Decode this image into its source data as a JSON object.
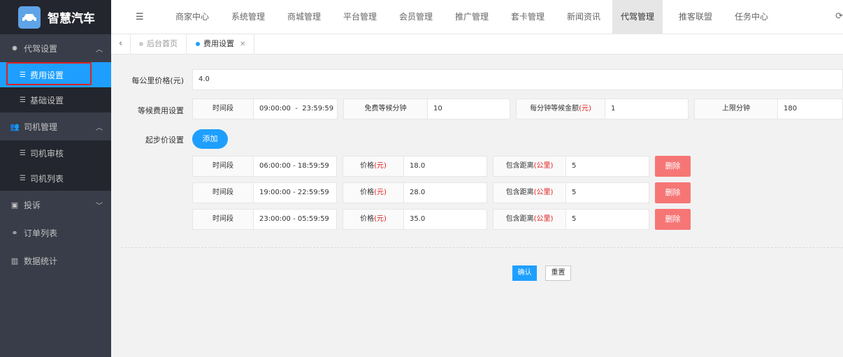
{
  "app": {
    "title": "智慧汽车"
  },
  "sidebar": {
    "groups": [
      {
        "label": "代驾设置",
        "icon": "gear-icon",
        "items": [
          {
            "label": "费用设置"
          },
          {
            "label": "基础设置"
          }
        ]
      },
      {
        "label": "司机管理",
        "icon": "users-icon",
        "items": [
          {
            "label": "司机审核"
          },
          {
            "label": "司机列表"
          }
        ]
      },
      {
        "label": "投诉",
        "icon": "complaint-icon"
      },
      {
        "label": "订单列表",
        "icon": "bicycle-icon"
      },
      {
        "label": "数据统计",
        "icon": "bar-chart-icon"
      }
    ]
  },
  "topnav": [
    "商家中心",
    "系统管理",
    "商城管理",
    "平台管理",
    "会员管理",
    "推广管理",
    "套卡管理",
    "新闻资讯",
    "代驾管理",
    "推客联盟",
    "任务中心"
  ],
  "tabs": [
    {
      "label": "后台首页"
    },
    {
      "label": "费用设置"
    }
  ],
  "form": {
    "per_km_label": "每公里价格(元)",
    "per_km_value": "4.0",
    "wait_label": "等候费用设置",
    "wait": {
      "time_label": "时间段",
      "time_value": "09:00:00  -  23:59:59",
      "free_label": "免费等候分钟",
      "free_value": "10",
      "per_min_label": "每分钟等候金额",
      "per_min_unit": "(元)",
      "per_min_value": "1",
      "limit_label": "上限分钟",
      "limit_value": "180"
    },
    "start_label": "起步价设置",
    "add_button": "添加",
    "rows": [
      {
        "time_label": "时间段",
        "time": "06:00:00 - 18:59:59",
        "price_label": "价格",
        "price_unit": "(元)",
        "price": "18.0",
        "dist_label": "包含距离",
        "dist_unit": "(公里)",
        "dist": "5",
        "delete": "删除"
      },
      {
        "time_label": "时间段",
        "time": "19:00:00 - 22:59:59",
        "price_label": "价格",
        "price_unit": "(元)",
        "price": "28.0",
        "dist_label": "包含距离",
        "dist_unit": "(公里)",
        "dist": "5",
        "delete": "删除"
      },
      {
        "time_label": "时间段",
        "time": "23:00:00 - 05:59:59",
        "price_label": "价格",
        "price_unit": "(元)",
        "price": "35.0",
        "dist_label": "包含距离",
        "dist_unit": "(公里)",
        "dist": "5",
        "delete": "删除"
      }
    ],
    "confirm": "确认",
    "reset": "重置"
  },
  "colors": {
    "primary": "#1e9fff",
    "danger": "#f67676",
    "highlight_box": "#e02020",
    "sidebar_bg": "#393d49"
  }
}
